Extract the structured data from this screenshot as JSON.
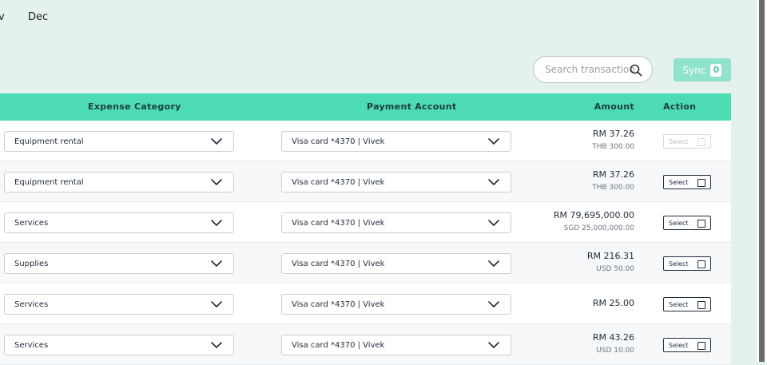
{
  "months": {
    "prev_partial": "v",
    "current": "Dec"
  },
  "search": {
    "placeholder": "Search transactions"
  },
  "sync": {
    "label": "Sync",
    "count": "0"
  },
  "table": {
    "headers": {
      "category": "Expense Category",
      "payment": "Payment Account",
      "amount": "Amount",
      "action": "Action"
    },
    "rows": [
      {
        "category": "Equipment rental",
        "payment": "Visa card *4370 | Vivek",
        "amount": "RM 37.26",
        "original": "THB 300.00",
        "action": "Select",
        "disabled": true
      },
      {
        "category": "Equipment rental",
        "payment": "Visa card *4370 | Vivek",
        "amount": "RM 37.26",
        "original": "THB 300.00",
        "action": "Select",
        "disabled": false
      },
      {
        "category": "Services",
        "payment": "Visa card *4370 | Vivek",
        "amount": "RM 79,695,000.00",
        "original": "SGD 25,000,000.00",
        "action": "Select",
        "disabled": false
      },
      {
        "category": "Supplies",
        "payment": "Visa card *4370 | Vivek",
        "amount": "RM 216.31",
        "original": "USD 50.00",
        "action": "Select",
        "disabled": false
      },
      {
        "category": "Services",
        "payment": "Visa card *4370 | Vivek",
        "amount": "RM 25.00",
        "original": "",
        "action": "Select",
        "disabled": false
      },
      {
        "category": "Services",
        "payment": "Visa card *4370 | Vivek",
        "amount": "RM 43.26",
        "original": "USD 10.00",
        "action": "Select",
        "disabled": false
      }
    ]
  },
  "colors": {
    "header": "#4ddbb4",
    "background": "#e4f1ed",
    "sync": "#8fe3cc"
  },
  "icons": {
    "search": "search-icon",
    "dropdown": "chevron-down-icon"
  }
}
